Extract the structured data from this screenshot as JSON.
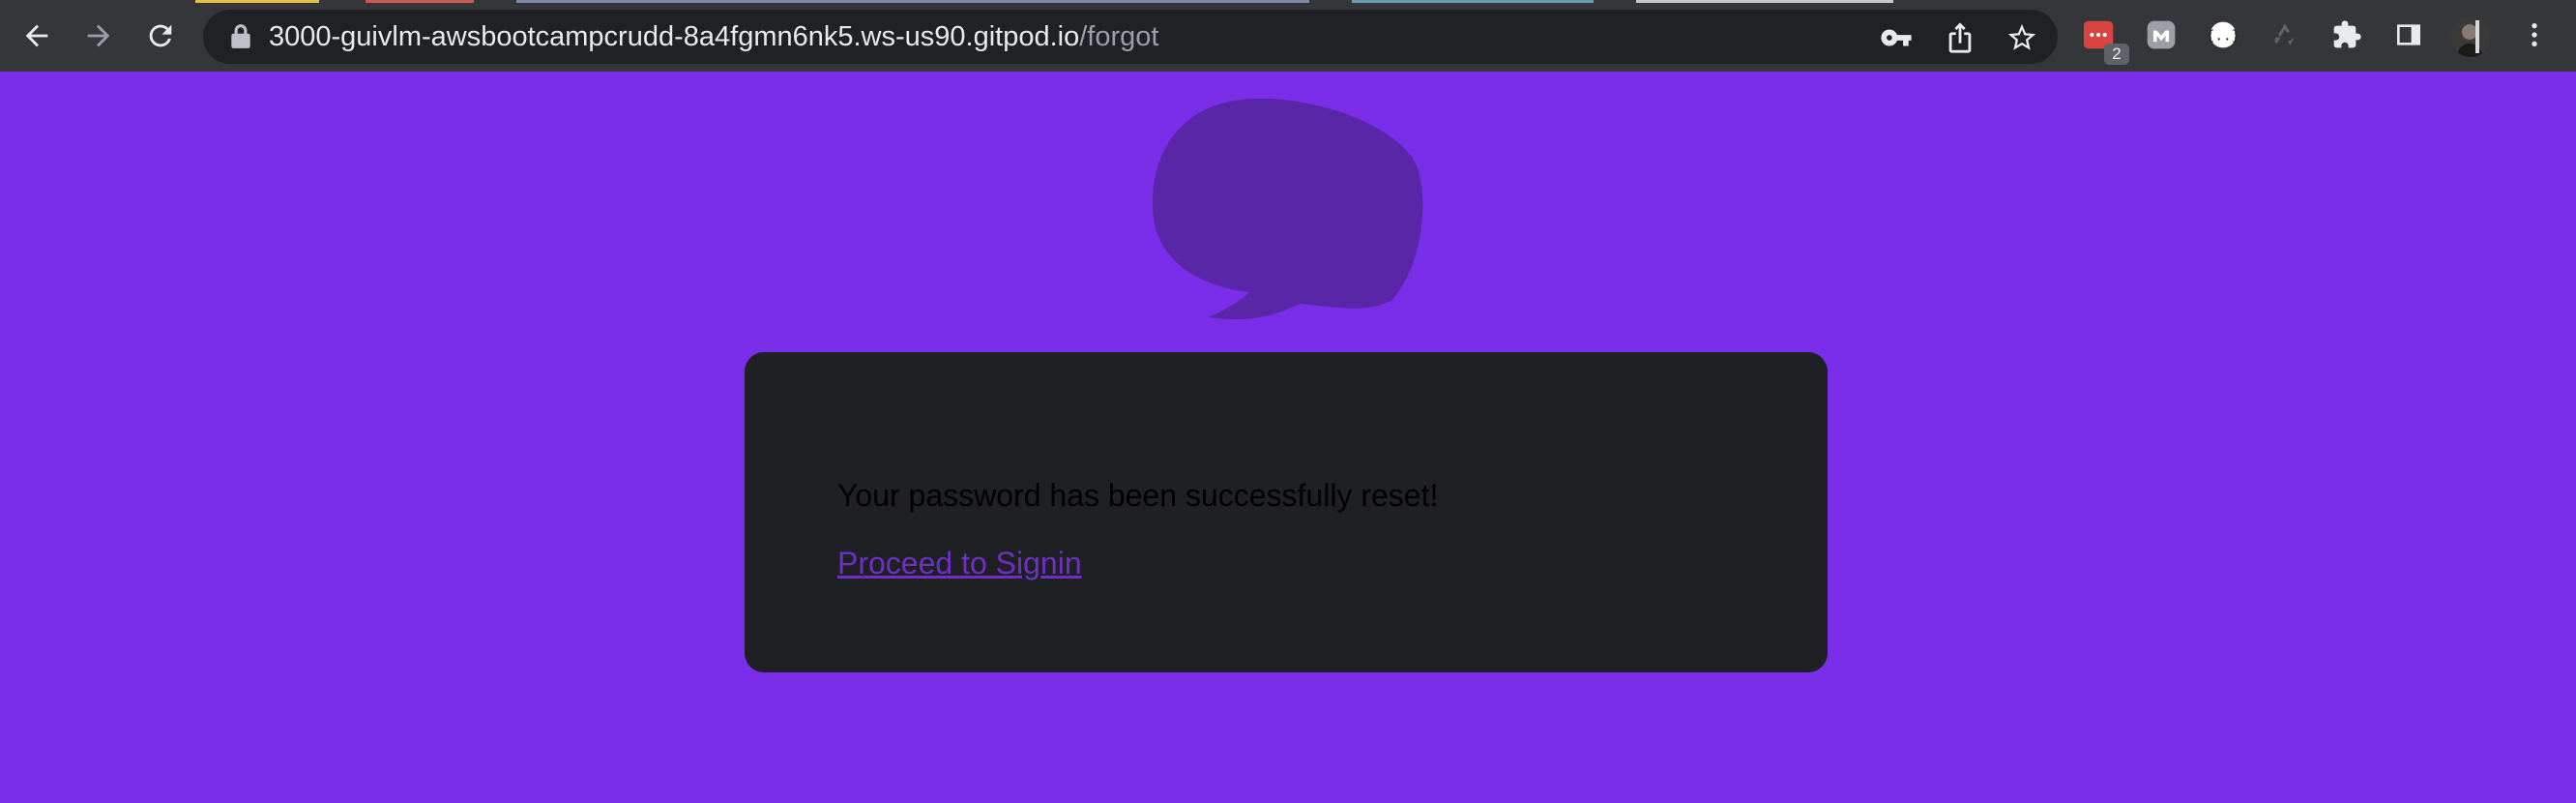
{
  "browser": {
    "url_host": "3000-guivlm-awsbootcampcrudd-8a4fgmn6nk5.ws-us90.gitpod.io",
    "url_path": "/forgot",
    "extension_badge_count": "2",
    "colors": {
      "toolbar": "#35363a",
      "omnibox": "#202124",
      "icon": "#e8eaed",
      "icon_disabled": "#9aa0a6"
    }
  },
  "page": {
    "background_color": "#7b2eea",
    "logo_icon": "speech-bubble-logo",
    "card": {
      "message": "Your password has been successfully reset!",
      "link_label": "Proceed to Signin"
    }
  }
}
